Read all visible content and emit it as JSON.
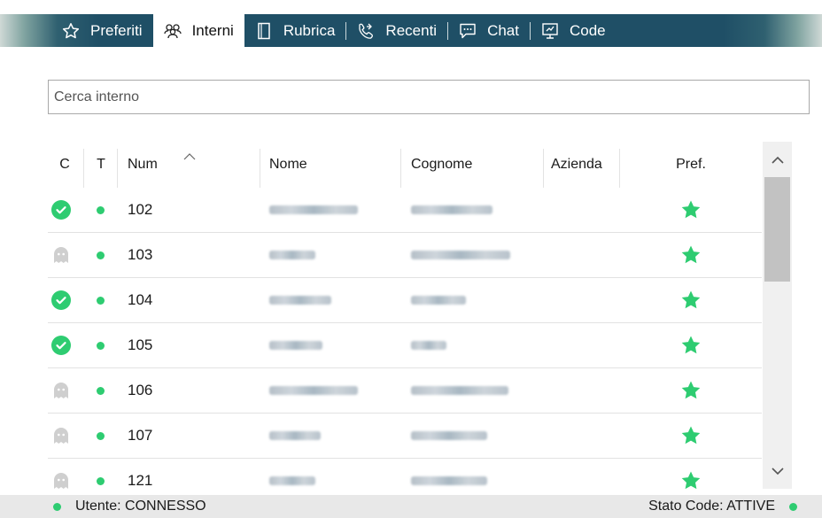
{
  "tabs": [
    {
      "label": "Preferiti",
      "icon": "star-outline-icon",
      "active": false
    },
    {
      "label": "Interni",
      "icon": "users-icon",
      "active": true
    },
    {
      "label": "Rubrica",
      "icon": "phonebook-icon",
      "active": false
    },
    {
      "label": "Recenti",
      "icon": "recent-calls-icon",
      "active": false
    },
    {
      "label": "Chat",
      "icon": "chat-icon",
      "active": false
    },
    {
      "label": "Code",
      "icon": "queue-icon",
      "active": false
    }
  ],
  "search": {
    "placeholder": "Cerca interno",
    "value": ""
  },
  "table": {
    "columns": {
      "c": "C",
      "t": "T",
      "num": "Num",
      "nome": "Nome",
      "cognome": "Cognome",
      "azienda": "Azienda",
      "pref": "Pref."
    },
    "sorted_column": "Num",
    "rows": [
      {
        "status": "online",
        "num": "102"
      },
      {
        "status": "offline",
        "num": "103"
      },
      {
        "status": "online",
        "num": "104"
      },
      {
        "status": "online",
        "num": "105"
      },
      {
        "status": "offline",
        "num": "106"
      },
      {
        "status": "offline",
        "num": "107"
      },
      {
        "status": "offline",
        "num": "121"
      }
    ]
  },
  "status_bar": {
    "left": "Utente: CONNESSO",
    "right": "Stato Code: ATTIVE"
  },
  "colors": {
    "accent_green": "#2ecc71",
    "tab_bar": "#1f4f66"
  }
}
